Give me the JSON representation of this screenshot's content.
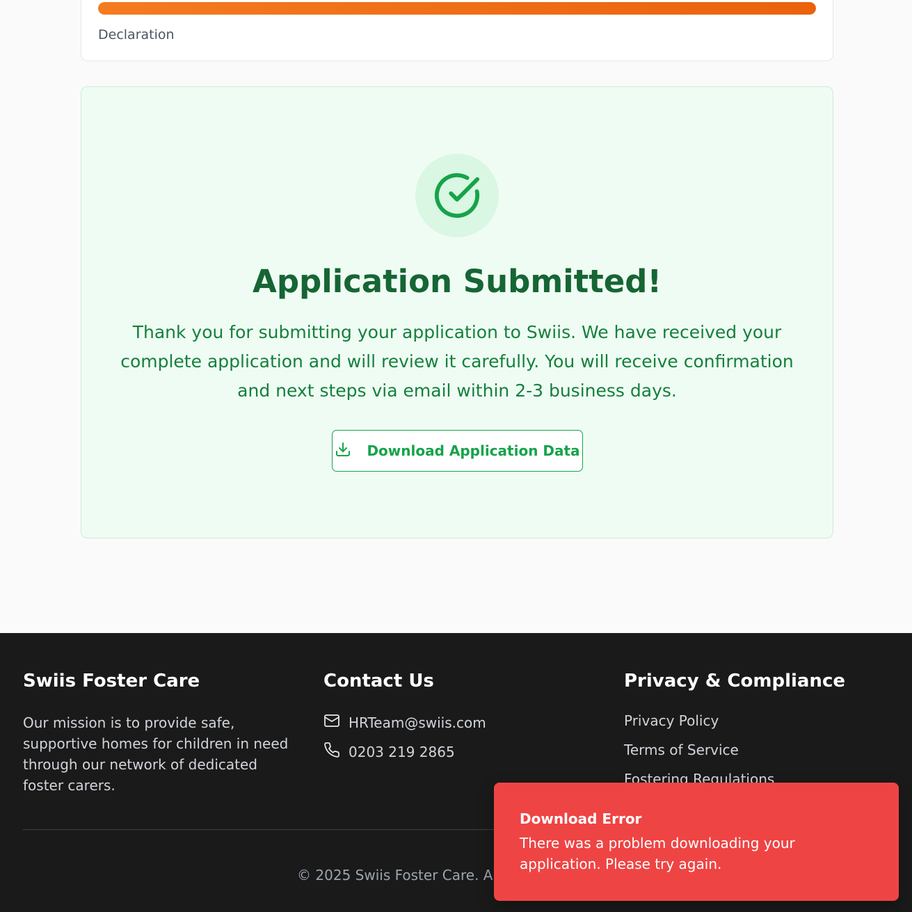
{
  "progress": {
    "fraction": 1.0,
    "step_label": "Declaration"
  },
  "success": {
    "title": "Application Submitted!",
    "message": "Thank you for submitting your application to Swiis. We have received your complete application and will review it carefully. You will receive confirmation and next steps via email within 2-3 business days.",
    "download_label": "Download Application Data",
    "icon": "check-circle-icon",
    "accent": "#16a34a"
  },
  "footer": {
    "about": {
      "heading": "Swiis Foster Care",
      "text": "Our mission is to provide safe, supportive homes for children in need through our network of dedicated foster carers."
    },
    "contact": {
      "heading": "Contact Us",
      "email": "HRTeam@swiis.com",
      "phone": "0203 219 2865"
    },
    "privacy": {
      "heading": "Privacy & Compliance",
      "links": [
        "Privacy Policy",
        "Terms of Service",
        "Fostering Regulations"
      ]
    },
    "copyright": "© 2025 Swiis Foster Care. All rights reserved."
  },
  "toast": {
    "title": "Download Error",
    "message": "There was a problem downloading your application. Please try again.",
    "color": "#ef4444"
  }
}
